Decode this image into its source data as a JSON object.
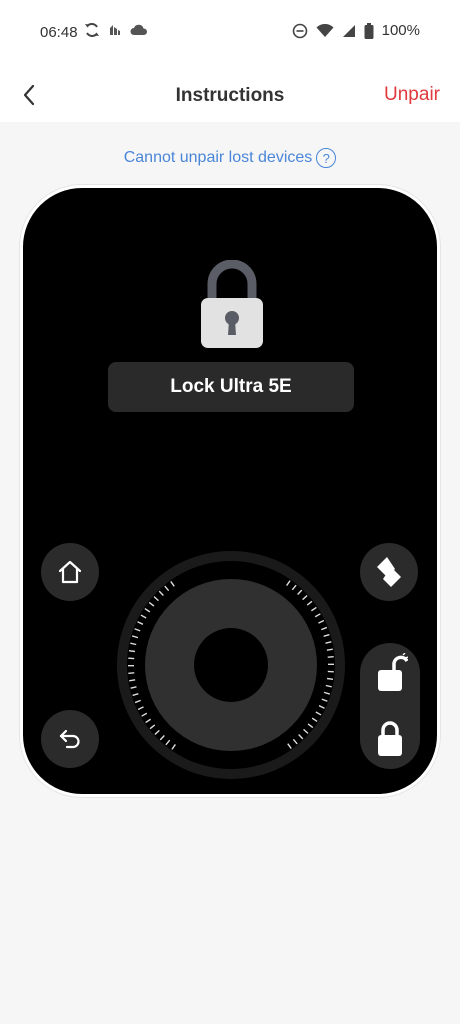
{
  "status_bar": {
    "time": "06:48",
    "battery": "100%",
    "icons": [
      "sync-icon",
      "app-notification-icon",
      "cloud-icon",
      "dnd-icon",
      "wifi-icon",
      "signal-icon",
      "battery-icon"
    ]
  },
  "header": {
    "title": "Instructions",
    "unpair_label": "Unpair",
    "back_icon": "chevron-left-icon"
  },
  "help_link": {
    "text": "Cannot unpair lost devices",
    "icon_text": "?"
  },
  "device": {
    "name": "Lock Ultra 5E",
    "lock_icon": "padlock-icon",
    "buttons": [
      "home-icon",
      "back-arrow-icon",
      "switch-icon",
      "unlock-icon",
      "lock-icon"
    ]
  },
  "colors": {
    "accent_red": "#e0393e",
    "link_blue": "#4a86d8",
    "panel_black": "#000000",
    "button_gray": "#2b2b2b"
  }
}
